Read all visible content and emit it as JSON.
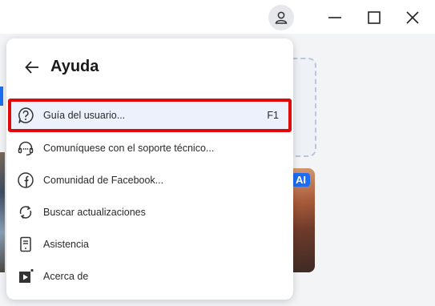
{
  "panel": {
    "title": "Ayuda",
    "items": [
      {
        "label": "Guía del usuario...",
        "shortcut": "F1",
        "icon": "question-icon"
      },
      {
        "label": "Comuníquese con el soporte técnico...",
        "shortcut": "",
        "icon": "headset-icon"
      },
      {
        "label": "Comunidad de Facebook...",
        "shortcut": "",
        "icon": "facebook-icon"
      },
      {
        "label": "Buscar actualizaciones",
        "shortcut": "",
        "icon": "refresh-icon"
      },
      {
        "label": "Asistencia",
        "shortcut": "",
        "icon": "document-icon"
      },
      {
        "label": "Acerca de",
        "shortcut": "",
        "icon": "about-icon"
      }
    ]
  },
  "background": {
    "badge": "AI"
  },
  "colors": {
    "accent": "#1b6ef3",
    "highlight_border": "#e00a0a",
    "selected_bg": "#edf1fb"
  }
}
